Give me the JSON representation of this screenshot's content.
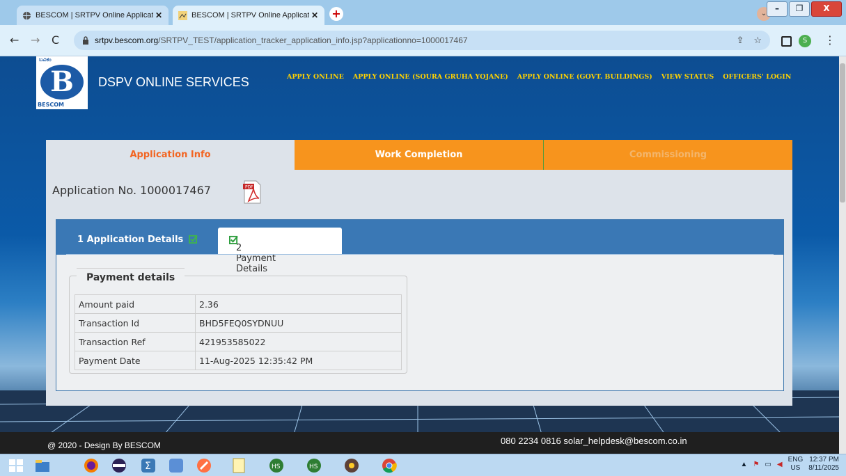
{
  "browser": {
    "tabs": [
      {
        "title": "BESCOM | SRTPV Online Applicat",
        "close": "✕",
        "active": false
      },
      {
        "title": "BESCOM | SRTPV Online Applicat",
        "close": "✕",
        "active": true
      }
    ],
    "new_tab": "+",
    "url_domain": "srtpv.bescom.org",
    "url_path": "/SRTPV_TEST/application_tracker_application_info.jsp?applicationno=1000017467",
    "profile_initial": "S",
    "window_buttons": {
      "minimize": "–",
      "maximize": "❐",
      "close": "X"
    }
  },
  "site": {
    "logo_top": "ಬವಿಕಂ",
    "logo_letter": "B",
    "logo_bottom": "BESCOM",
    "brand": "DSPV ONLINE SERVICES",
    "nav": [
      "APPLY ONLINE",
      "APPLY ONLINE (SOURA GRUHA YOJANE)",
      "APPLY ONLINE (GOVT. BUILDINGS)",
      "VIEW STATUS",
      "OFFICERS' LOGIN"
    ]
  },
  "main": {
    "tabs": [
      "Application Info",
      "Work Completion",
      "Commissioning"
    ],
    "application_no": "Application No. 1000017467",
    "pdf_label": "PDF",
    "steps": [
      "1 Application Details",
      "2 Payment Details"
    ],
    "payment": {
      "legend": "Payment details",
      "rows": [
        {
          "key": "Amount paid",
          "value": "2.36"
        },
        {
          "key": "Transaction Id",
          "value": "BHD5FEQ0SYDNUU"
        },
        {
          "key": "Transaction Ref",
          "value": "421953585022"
        },
        {
          "key": "Payment Date",
          "value": "11-Aug-2025 12:35:42 PM"
        }
      ]
    }
  },
  "footer": {
    "left": "@ 2020 - Design By  BESCOM",
    "right": "080 2234 0816   solar_helpdesk@bescom.co.in"
  },
  "taskbar": {
    "lang": "ENG",
    "region": "US",
    "time": "12:37 PM",
    "date": "8/11/2025"
  },
  "colors": {
    "tab_active_text": "#f26522",
    "tab_orange": "#f7941d",
    "header_blue": "#3a78b5",
    "nav_yellow": "#ffd200"
  }
}
